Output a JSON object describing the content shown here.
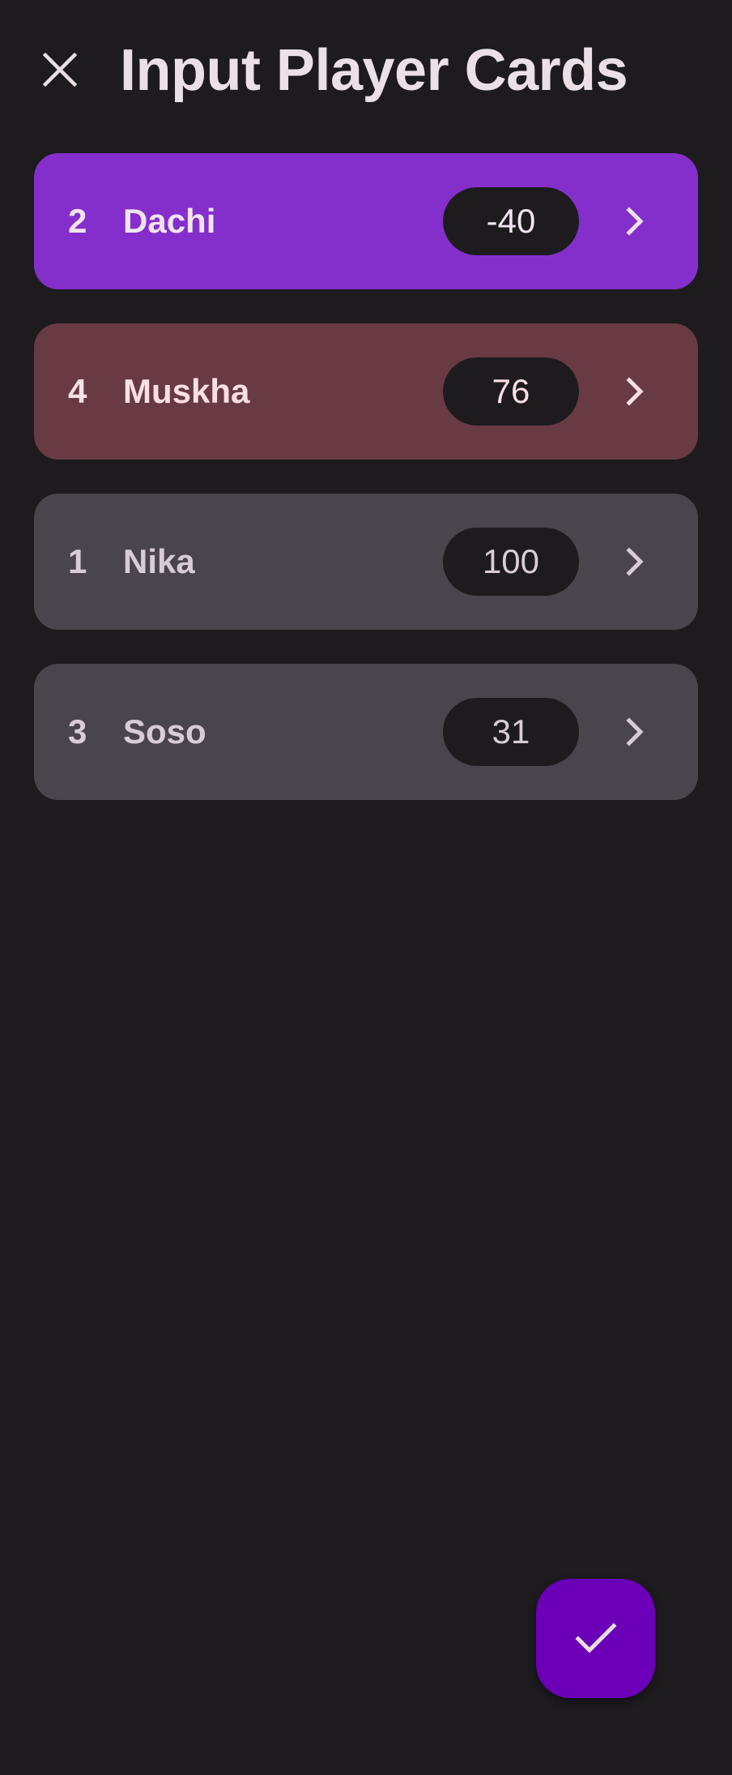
{
  "header": {
    "title": "Input Player Cards",
    "close_icon": "close-icon"
  },
  "players": [
    {
      "rank": "2",
      "name": "Dachi",
      "score": "-40",
      "card_color": "#842fcc",
      "text_color": "#f2e4f3",
      "chevron_icon": "chevron-right-icon"
    },
    {
      "rank": "4",
      "name": "Muskha",
      "score": "76",
      "card_color": "#683a44",
      "text_color": "#ffdfe6",
      "chevron_icon": "chevron-right-icon"
    },
    {
      "rank": "1",
      "name": "Nika",
      "score": "100",
      "card_color": "#4a454c",
      "text_color": "#d8ccd6",
      "chevron_icon": "chevron-right-icon"
    },
    {
      "rank": "3",
      "name": "Soso",
      "score": "31",
      "card_color": "#4a454c",
      "text_color": "#d8ccd6",
      "chevron_icon": "chevron-right-icon"
    }
  ],
  "fab": {
    "icon": "check-icon",
    "color": "#6b00b8"
  }
}
